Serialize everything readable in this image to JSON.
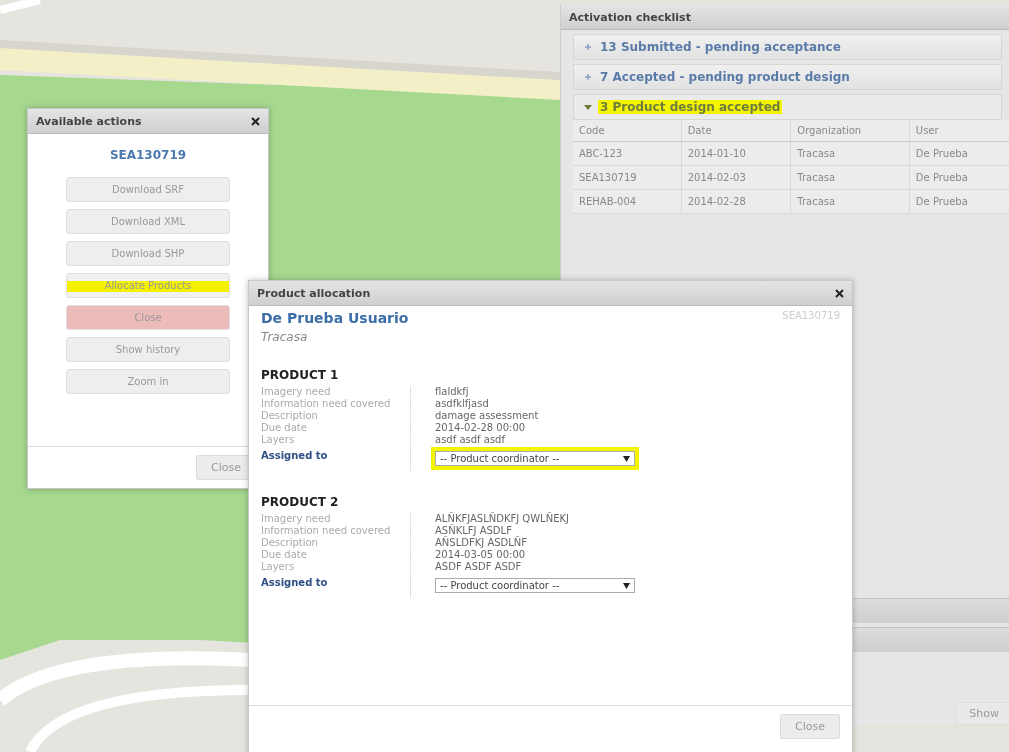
{
  "checklist": {
    "title": "Activation checklist",
    "groups": [
      {
        "label": "13 Submitted - pending acceptance",
        "expanded": false,
        "highlighted": false
      },
      {
        "label": "7 Accepted - pending product design",
        "expanded": false,
        "highlighted": false
      },
      {
        "label": "3 Product design accepted",
        "expanded": true,
        "highlighted": true
      }
    ],
    "table": {
      "columns": [
        "Code",
        "Date",
        "Organization",
        "User"
      ],
      "rows": [
        [
          "ABC-123",
          "2014-01-10",
          "Tracasa",
          "De Prueba"
        ],
        [
          "SEA130719",
          "2014-02-03",
          "Tracasa",
          "De Prueba"
        ],
        [
          "REHAB-004",
          "2014-02-28",
          "Tracasa",
          "De Prueba"
        ]
      ]
    },
    "show_button": "Show"
  },
  "actions_dialog": {
    "title": "Available actions",
    "code": "SEA130719",
    "buttons": [
      {
        "label": "Download SRF",
        "kind": "normal",
        "highlighted": false
      },
      {
        "label": "Download XML",
        "kind": "normal",
        "highlighted": false
      },
      {
        "label": "Download SHP",
        "kind": "normal",
        "highlighted": false
      },
      {
        "label": "Allocate Products",
        "kind": "normal",
        "highlighted": true
      },
      {
        "label": "Close",
        "kind": "danger",
        "highlighted": false
      },
      {
        "label": "Show history",
        "kind": "normal",
        "highlighted": false
      },
      {
        "label": "Zoom in",
        "kind": "normal",
        "highlighted": false
      }
    ],
    "footer_button": "Close"
  },
  "allocation_dialog": {
    "title": "Product allocation",
    "user": "De Prueba Usuario",
    "organization": "Tracasa",
    "code": "SEA130719",
    "products": [
      {
        "title": "PRODUCT 1",
        "fields": [
          {
            "label": "Imagery need",
            "value": "flaldkfj"
          },
          {
            "label": "Information need covered",
            "value": "asdfklfjasd"
          },
          {
            "label": "Description",
            "value": "damage assessment"
          },
          {
            "label": "Due date",
            "value": "2014-02-28 00:00"
          },
          {
            "label": "Layers",
            "value": "asdf asdf asdf"
          }
        ],
        "assigned": {
          "label": "Assigned to",
          "value": "-- Product coordinator --",
          "highlighted": true
        }
      },
      {
        "title": "PRODUCT 2",
        "fields": [
          {
            "label": "Imagery need",
            "value": "ALÑKFJASLÑDKFJ QWLÑEKJ"
          },
          {
            "label": "Information need covered",
            "value": "ASÑKLFJ ASDLF"
          },
          {
            "label": "Description",
            "value": "AÑSLDFKJ ASDLÑF"
          },
          {
            "label": "Due date",
            "value": "2014-03-05 00:00"
          },
          {
            "label": "Layers",
            "value": "ASDF ASDF ASDF"
          }
        ],
        "assigned": {
          "label": "Assigned to",
          "value": "-- Product coordinator --",
          "highlighted": false
        }
      }
    ],
    "footer_button": "Close"
  }
}
